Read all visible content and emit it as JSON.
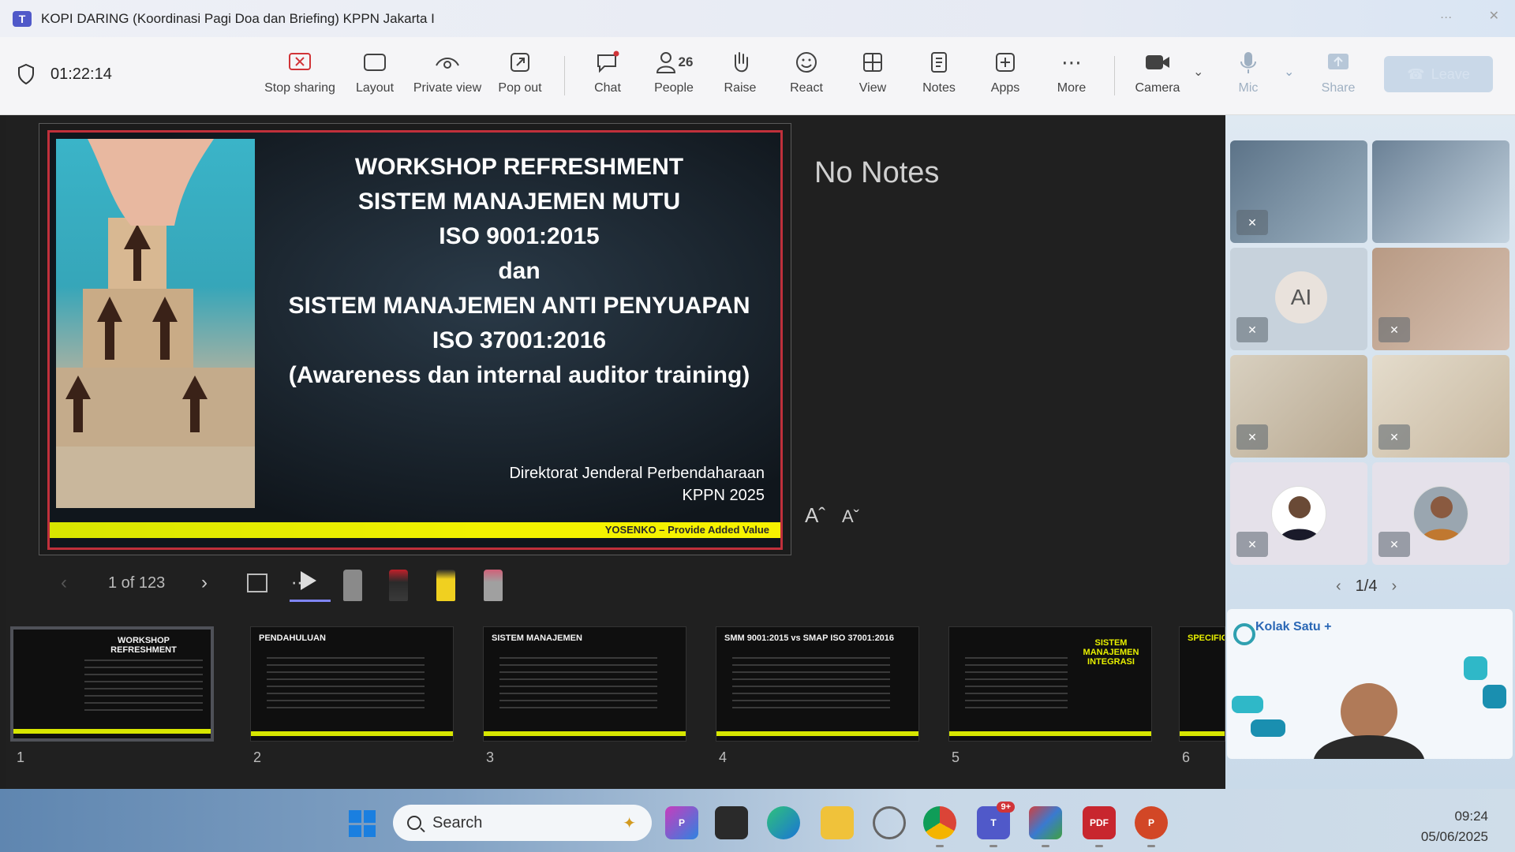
{
  "window": {
    "title": "KOPI DARING (Koordinasi Pagi Doa dan Briefing) KPPN Jakarta I"
  },
  "toolbar": {
    "timer": "01:22:14",
    "stop_sharing": "Stop sharing",
    "layout": "Layout",
    "private_view": "Private view",
    "pop_out": "Pop out",
    "chat": "Chat",
    "people": "People",
    "people_count": "26",
    "raise": "Raise",
    "react": "React",
    "view": "View",
    "notes": "Notes",
    "apps": "Apps",
    "more": "More",
    "camera": "Camera",
    "mic": "Mic",
    "share": "Share",
    "leave": "Leave"
  },
  "slide": {
    "title_lines": [
      "WORKSHOP REFRESHMENT",
      "SISTEM MANAJEMEN MUTU",
      "ISO 9001:2015",
      "dan",
      "SISTEM MANAJEMEN ANTI PENYUAPAN",
      "ISO 37001:2016",
      "(Awareness dan internal auditor training)"
    ],
    "footer_line1": "Direktorat Jenderal Perbendaharaan",
    "footer_line2": "KPPN 2025",
    "tagline": "YOSENKO – Provide Added Value"
  },
  "notes": {
    "text": "No Notes",
    "font_up": "Aˆ",
    "font_down": "Aˇ"
  },
  "navigation": {
    "page_indicator": "1 of 123"
  },
  "thumbnails": [
    {
      "num": "1",
      "title": "WORKSHOP REFRESHMENT"
    },
    {
      "num": "2",
      "title": "PENDAHULUAN"
    },
    {
      "num": "3",
      "title": "SISTEM MANAJEMEN"
    },
    {
      "num": "4",
      "title": "SMM 9001:2015 vs SMAP ISO 37001:2016"
    },
    {
      "num": "5",
      "title": "SISTEM MANAJEMEN INTEGRASI"
    },
    {
      "num": "6",
      "title": "SPECIFIC"
    }
  ],
  "participants": {
    "initials_tile": "AI",
    "pager": "1/4",
    "speaker_brand": "Kolak Satu +"
  },
  "taskbar": {
    "search_label": "Search",
    "teams_badge": "9+",
    "time": "09:24",
    "date": "05/06/2025"
  },
  "colors": {
    "slide_border": "#c0303b",
    "slide_bar": "#e8f000",
    "teams_accent": "#5059c9",
    "stop_sharing": "#d13438"
  }
}
